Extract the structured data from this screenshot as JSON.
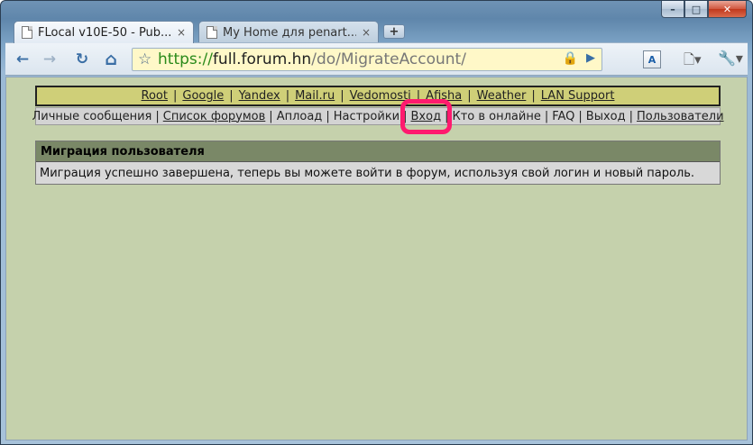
{
  "window": {
    "controls": {
      "minimize": "–",
      "maximize": "□",
      "close": "✕"
    }
  },
  "tabs": [
    {
      "title": "FLocal v10E-50 - Pub...",
      "close": "×",
      "active": true
    },
    {
      "title": "My Home для penart...",
      "close": "×",
      "active": false
    }
  ],
  "new_tab": "+",
  "toolbar": {
    "back_icon": "←",
    "forward_icon": "→",
    "reload_icon": "↻",
    "home_icon": "⌂",
    "star_icon": "☆",
    "url_scheme": "https://",
    "url_host": "full.forum.hn",
    "url_path": "/do/MigrateAccount/",
    "lock_icon": "🔒",
    "go_icon": "▶",
    "extension_label": "A",
    "page_menu_icon": "🗋▾",
    "wrench_icon": "🔧▾"
  },
  "nav_top": {
    "links": [
      "Root",
      "Google",
      "Yandex",
      "Mail.ru",
      "Vedomosti",
      "Afisha",
      "Weather",
      "LAN Support"
    ],
    "separator": "|"
  },
  "nav_bottom": {
    "items": [
      {
        "label": "Личные сообщения",
        "link": false
      },
      {
        "label": "Список форумов",
        "link": true
      },
      {
        "label": "Аплоад",
        "link": false
      },
      {
        "label": "Настройки",
        "link": false
      },
      {
        "label": "Вход",
        "link": true
      },
      {
        "label": "Кто в онлайне",
        "link": false
      },
      {
        "label": "FAQ",
        "link": false
      },
      {
        "label": "Выход",
        "link": false
      },
      {
        "label": "Пользователи",
        "link": true
      }
    ],
    "separator": "|"
  },
  "panel": {
    "title": "Миграция пользователя",
    "message": "Миграция успешно завершена, теперь вы можете войти в форум, используя свой логин и новый пароль."
  },
  "colors": {
    "content_bg": "#c5d1ac",
    "nav_top_bg": "#cfcf78",
    "highlight": "#ff1a6e",
    "url_scheme": "#2a8a1a"
  }
}
